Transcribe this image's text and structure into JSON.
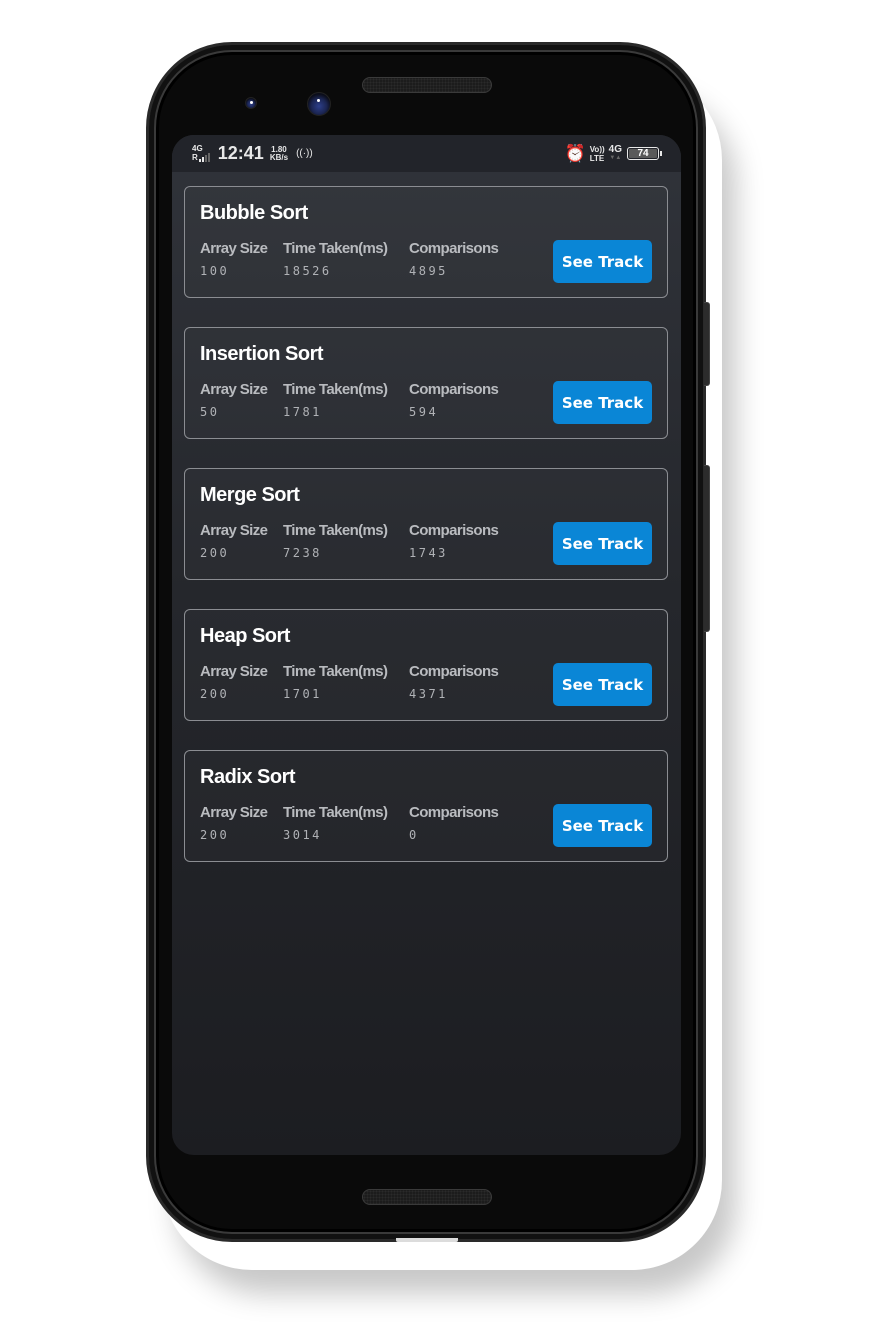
{
  "status_bar": {
    "network_type": "4G",
    "roaming_indicator": "R",
    "time": "12:41",
    "speed_value": "1.80",
    "speed_unit": "KB/s",
    "hotspot_icon": "((·))",
    "alarm_icon": "⏰",
    "volte_top": "Vo))",
    "volte_bottom": "LTE",
    "data_network": "4G",
    "data_arrows": "▼▲",
    "battery_level": "74"
  },
  "colors": {
    "accent": "#0a86d6",
    "card_border": "#8b8d92",
    "background": "#25272c"
  },
  "labels": {
    "array_size": "Array Size",
    "time_taken": "Time Taken(ms)",
    "comparisons": "Comparisons",
    "see_track": "See Track"
  },
  "sorts": [
    {
      "name": "Bubble Sort",
      "array_size": "100",
      "time_taken": "18526",
      "comparisons": "4895"
    },
    {
      "name": "Insertion Sort",
      "array_size": "50",
      "time_taken": "1781",
      "comparisons": "594"
    },
    {
      "name": "Merge Sort",
      "array_size": "200",
      "time_taken": "7238",
      "comparisons": "1743"
    },
    {
      "name": "Heap Sort",
      "array_size": "200",
      "time_taken": "1701",
      "comparisons": "4371"
    },
    {
      "name": "Radix Sort",
      "array_size": "200",
      "time_taken": "3014",
      "comparisons": "0"
    }
  ]
}
